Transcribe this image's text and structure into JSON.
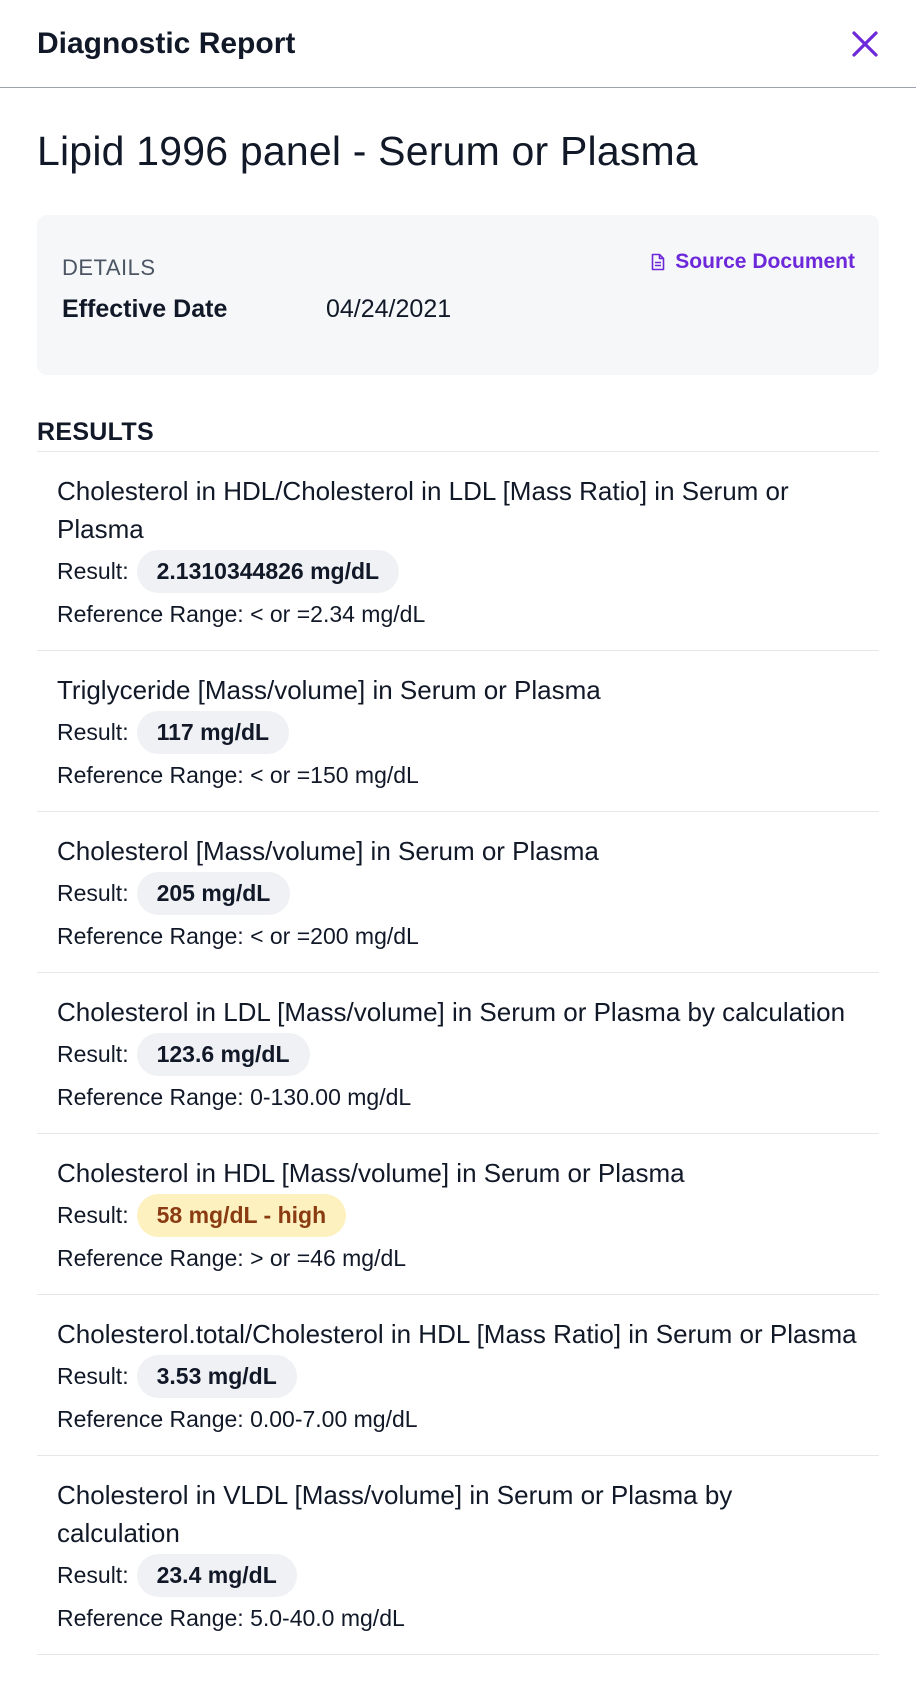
{
  "header": {
    "title": "Diagnostic Report"
  },
  "page": {
    "title": "Lipid 1996 panel - Serum or Plasma"
  },
  "details": {
    "label": "DETAILS",
    "source_link": "Source Document",
    "effective_date_label": "Effective Date",
    "effective_date_value": "04/24/2021"
  },
  "results_label": "RESULTS",
  "results": [
    {
      "name": "Cholesterol in HDL/Cholesterol in LDL [Mass Ratio] in Serum or Plasma",
      "result_label": "Result:",
      "value": "2.1310344826 mg/dL",
      "flag": "normal",
      "reference": "Reference Range: < or =2.34 mg/dL"
    },
    {
      "name": "Triglyceride [Mass/volume] in Serum or Plasma",
      "result_label": "Result:",
      "value": "117 mg/dL",
      "flag": "normal",
      "reference": "Reference Range: < or =150 mg/dL"
    },
    {
      "name": "Cholesterol [Mass/volume] in Serum or Plasma",
      "result_label": "Result:",
      "value": "205 mg/dL",
      "flag": "normal",
      "reference": "Reference Range: < or =200 mg/dL"
    },
    {
      "name": "Cholesterol in LDL [Mass/volume] in Serum or Plasma by calculation",
      "result_label": "Result:",
      "value": "123.6 mg/dL",
      "flag": "normal",
      "reference": "Reference Range: 0-130.00 mg/dL"
    },
    {
      "name": "Cholesterol in HDL [Mass/volume] in Serum or Plasma",
      "result_label": "Result:",
      "value": "58 mg/dL - high",
      "flag": "high",
      "reference": "Reference Range: > or =46 mg/dL"
    },
    {
      "name": "Cholesterol.total/Cholesterol in HDL [Mass Ratio] in Serum or Plasma",
      "result_label": "Result:",
      "value": "3.53 mg/dL",
      "flag": "normal",
      "reference": "Reference Range: 0.00-7.00 mg/dL"
    },
    {
      "name": "Cholesterol in VLDL [Mass/volume] in Serum or Plasma by calculation",
      "result_label": "Result:",
      "value": "23.4 mg/dL",
      "flag": "normal",
      "reference": "Reference Range: 5.0-40.0 mg/dL"
    }
  ],
  "icons": {
    "close": "close-icon",
    "document": "document-icon"
  },
  "colors": {
    "accent": "#6d28d9",
    "high_bg": "#fdf1c0",
    "high_text": "#8a3b12",
    "pill_bg": "#f0f1f4"
  }
}
